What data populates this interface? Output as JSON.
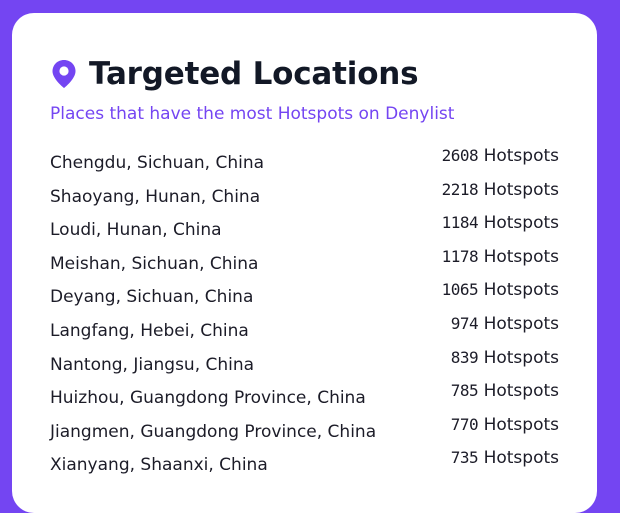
{
  "header": {
    "icon": "location-pin-icon",
    "title": "Targeted Locations",
    "subtitle": "Places that have the most Hotspots on Denylist"
  },
  "colors": {
    "background": "#7445f2",
    "accent": "#7445f2",
    "text": "#121826",
    "card": "#ffffff"
  },
  "locations": [
    {
      "name": "Chengdu, Sichuan, China",
      "count": "2608",
      "unit": "Hotspots"
    },
    {
      "name": "Shaoyang, Hunan, China",
      "count": "2218",
      "unit": "Hotspots"
    },
    {
      "name": "Loudi, Hunan, China",
      "count": "1184",
      "unit": "Hotspots"
    },
    {
      "name": "Meishan, Sichuan, China",
      "count": "1178",
      "unit": "Hotspots"
    },
    {
      "name": "Deyang, Sichuan, China",
      "count": "1065",
      "unit": "Hotspots"
    },
    {
      "name": "Langfang, Hebei, China",
      "count": "974",
      "unit": "Hotspots"
    },
    {
      "name": "Nantong, Jiangsu, China",
      "count": "839",
      "unit": "Hotspots"
    },
    {
      "name": "Huizhou, Guangdong Province, China",
      "count": "785",
      "unit": "Hotspots"
    },
    {
      "name": "Jiangmen, Guangdong Province, China",
      "count": "770",
      "unit": "Hotspots"
    },
    {
      "name": "Xianyang, Shaanxi, China",
      "count": "735",
      "unit": "Hotspots"
    }
  ]
}
